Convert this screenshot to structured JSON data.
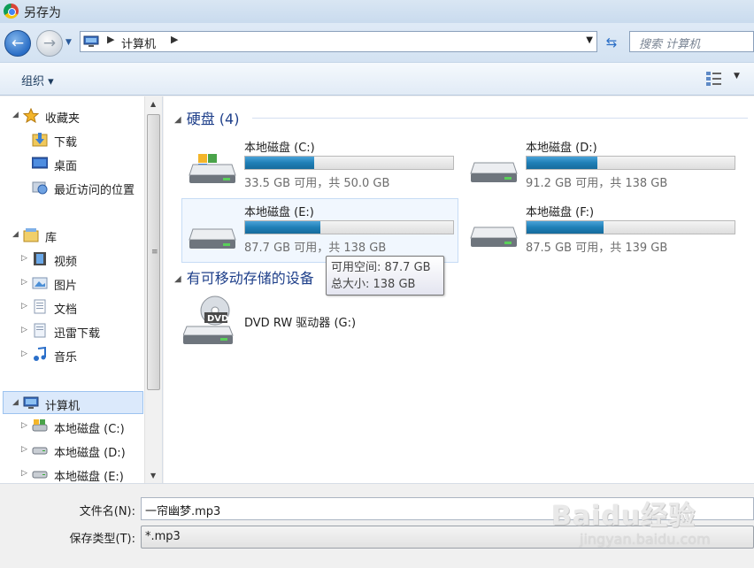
{
  "window": {
    "title": "另存为"
  },
  "address": {
    "path": "计算机",
    "search_placeholder": "搜索 计算机"
  },
  "toolbar": {
    "organize_label": "组织 ▾"
  },
  "nav": {
    "favorites": {
      "label": "收藏夹",
      "items": [
        "下载",
        "桌面",
        "最近访问的位置"
      ]
    },
    "libraries": {
      "label": "库",
      "items": [
        "视频",
        "图片",
        "文档",
        "迅雷下载",
        "音乐"
      ]
    },
    "computer": {
      "label": "计算机",
      "items": [
        "本地磁盘 (C:)",
        "本地磁盘 (D:)",
        "本地磁盘 (E:)"
      ]
    }
  },
  "groups": {
    "hard_disks": {
      "header": "硬盘 (4)"
    },
    "removable": {
      "header": "有可移动存储的设备"
    }
  },
  "drives": [
    {
      "name": "本地磁盘 (C:)",
      "info": "33.5 GB 可用，共 50.0 GB",
      "used_fraction": 0.33
    },
    {
      "name": "本地磁盘 (D:)",
      "info": "91.2 GB 可用，共 138 GB",
      "used_fraction": 0.34
    },
    {
      "name": "本地磁盘 (E:)",
      "info": "87.7 GB 可用，共 138 GB",
      "used_fraction": 0.36
    },
    {
      "name": "本地磁盘 (F:)",
      "info": "87.5 GB 可用，共 139 GB",
      "used_fraction": 0.37
    }
  ],
  "dvd": {
    "name": "DVD RW 驱动器 (G:)",
    "badge": "DVD"
  },
  "tooltip": {
    "line1": "可用空间: 87.7 GB",
    "line2": "总大小: 138 GB"
  },
  "form": {
    "filename_label": "文件名(N):",
    "filename_value": "一帘幽梦.mp3",
    "filetype_label": "保存类型(T):",
    "filetype_value": "*.mp3"
  },
  "watermark": {
    "text": "Baidu经验",
    "sub": "jingyan.baidu.com"
  }
}
